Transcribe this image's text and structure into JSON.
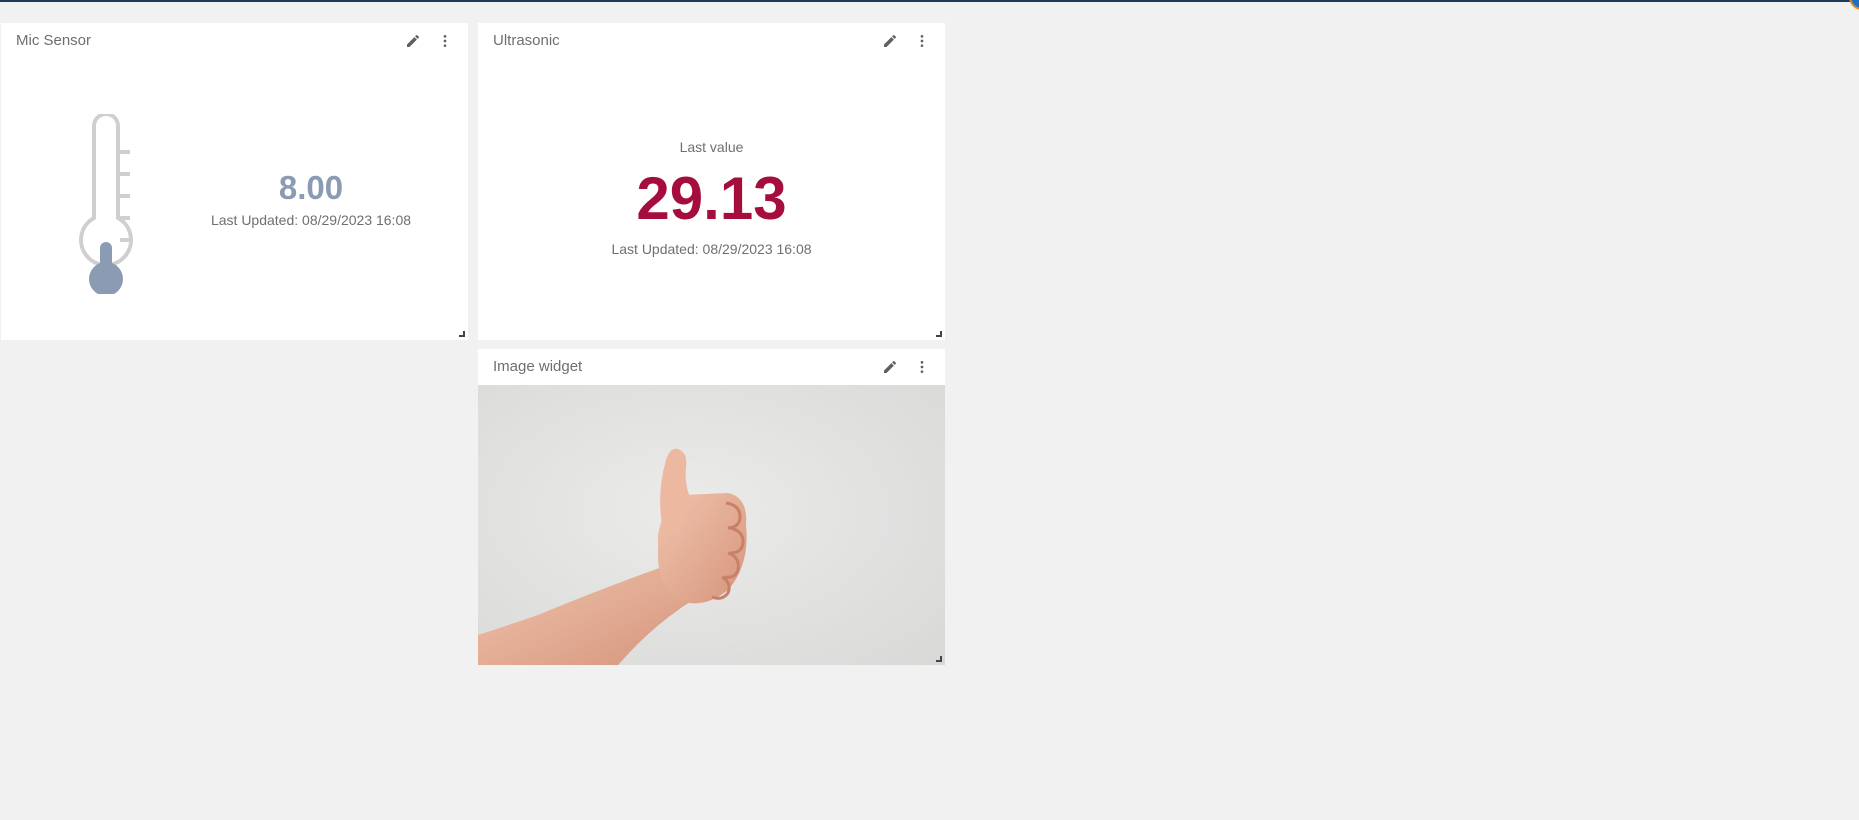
{
  "colors": {
    "page_background": "#f1f1f1",
    "widget_background": "#ffffff",
    "top_rule": "#1f3a55",
    "mic_value": "#8a9bb3",
    "ultrasonic_value": "#a50d3c",
    "thermometer_fill": "#8a9bb3"
  },
  "widgets": {
    "mic": {
      "title": "Mic Sensor",
      "value": "8.00",
      "last_updated": "Last Updated: 08/29/2023 16:08",
      "icons": [
        "thermometer-icon",
        "pencil-icon",
        "more-vert-icon"
      ]
    },
    "ultrasonic": {
      "title": "Ultrasonic",
      "label": "Last value",
      "value": "29.13",
      "last_updated": "Last Updated: 08/29/2023 16:08",
      "icons": [
        "pencil-icon",
        "more-vert-icon"
      ]
    },
    "image": {
      "title": "Image widget",
      "icons": [
        "pencil-icon",
        "more-vert-icon"
      ]
    }
  }
}
